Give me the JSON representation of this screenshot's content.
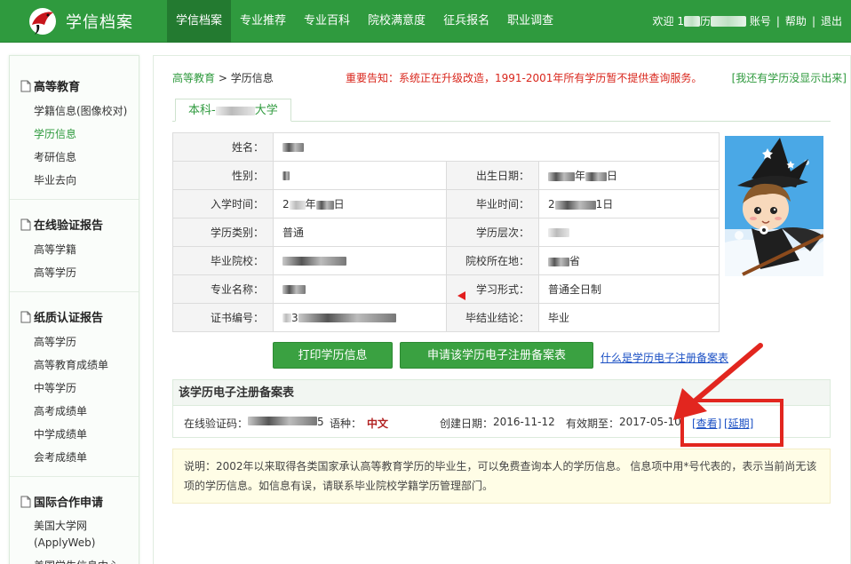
{
  "header": {
    "site_title": "学信档案",
    "nav": [
      {
        "label": "学信档案"
      },
      {
        "label": "专业推荐"
      },
      {
        "label": "专业百科"
      },
      {
        "label": "院校满意度"
      },
      {
        "label": "征兵报名"
      },
      {
        "label": "职业调查"
      }
    ],
    "welcome": "欢迎",
    "welcome_initial": "1",
    "welcome_mid": "历",
    "account": "账号",
    "help": "帮助",
    "logout": "退出",
    "separator": "|"
  },
  "sidebar": {
    "groups": [
      {
        "title": "高等教育",
        "items": [
          {
            "label": "学籍信息(图像校对)"
          },
          {
            "label": "学历信息"
          },
          {
            "label": "考研信息"
          },
          {
            "label": "毕业去向"
          }
        ]
      },
      {
        "title": "在线验证报告",
        "items": [
          {
            "label": "高等学籍"
          },
          {
            "label": "高等学历"
          }
        ]
      },
      {
        "title": "纸质认证报告",
        "items": [
          {
            "label": "高等学历"
          },
          {
            "label": "高等教育成绩单"
          },
          {
            "label": "中等学历"
          },
          {
            "label": "高考成绩单"
          },
          {
            "label": "中学成绩单"
          },
          {
            "label": "会考成绩单"
          }
        ]
      },
      {
        "title": "国际合作申请",
        "items": [
          {
            "label": "美国大学网(ApplyWeb)"
          },
          {
            "label": "美国学生信息中心"
          }
        ]
      }
    ]
  },
  "breadcrumb": {
    "home": "高等教育",
    "sep": ">",
    "current": "学历信息"
  },
  "notice": "重要告知：系统正在升级改造，1991-2001年所有学历暂不提供查询服务。",
  "missing_link": "[我还有学历没显示出来]",
  "tab": {
    "prefix": "本科-",
    "suffix": "大学"
  },
  "record": {
    "name_label": "姓名：",
    "gender_label": "性别：",
    "birth_label": "出生日期：",
    "birth_year_sep": "年",
    "birth_day_sep": "日",
    "enroll_label": "入学时间：",
    "enroll_prefix": "2",
    "enroll_year_sep": "年",
    "enroll_day_sep": "日",
    "grad_label": "毕业时间：",
    "grad_prefix": "2",
    "grad_day": "1日",
    "type_label": "学历类别：",
    "type_value": "普通",
    "level_label": "学历层次：",
    "school_label": "毕业院校：",
    "location_label": "院校所在地：",
    "location_suffix": "省",
    "major_label": "专业名称：",
    "form_label": "学习形式：",
    "form_value": "普通全日制",
    "cert_label": "证书编号：",
    "cert_digit": "3",
    "conclusion_label": "毕结业结论：",
    "conclusion_value": "毕业"
  },
  "buttons": {
    "print": "打印学历信息",
    "apply": "申请该学历电子注册备案表",
    "what_is": "什么是学历电子注册备案表"
  },
  "registration": {
    "heading": "该学历电子注册备案表",
    "code_label": "在线验证码：",
    "code_tail": "5",
    "lang_label": "语种：",
    "lang_value": "中文",
    "created_label": "创建日期：",
    "created_value": "2016-11-12",
    "valid_label": "有效期至：",
    "valid_value": "2017-05-10",
    "view": "[查看]",
    "extend": "[延期]"
  },
  "note": "说明：2002年以来取得各类国家承认高等教育学历的毕业生，可以免费查询本人的学历信息。  信息项中用*号代表的，表示当前尚无该项的学历信息。如信息有误，请联系毕业院校学籍学历管理部门。",
  "colors": {
    "brand_green": "#2f9a3e",
    "notice_red": "#d9261c",
    "link_blue": "#1a4fc4",
    "annotation_red": "#e2261f"
  }
}
